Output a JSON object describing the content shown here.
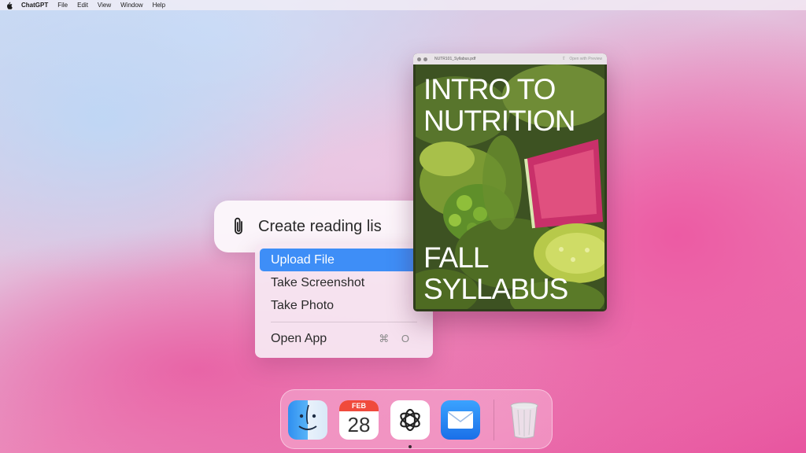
{
  "menubar": {
    "apple_icon": "apple-logo-icon",
    "items": [
      "ChatGPT",
      "File",
      "Edit",
      "View",
      "Window",
      "Help"
    ]
  },
  "prompt": {
    "icon": "paperclip-icon",
    "text": "Create reading lis"
  },
  "context_menu": {
    "items": [
      {
        "label": "Upload File",
        "selected": true
      },
      {
        "label": "Take Screenshot"
      },
      {
        "label": "Take Photo"
      }
    ],
    "open_app": {
      "label": "Open App",
      "shortcut": "⌘ O"
    }
  },
  "pdf_window": {
    "filename": "NUTR101_Syllabus.pdf",
    "open_with": "Open with Preview",
    "cover_title": [
      "INTRO TO",
      "NUTRITION"
    ],
    "cover_subtitle": [
      "FALL",
      "SYLLABUS"
    ]
  },
  "dock": {
    "apps": [
      "finder-icon",
      "calendar-icon",
      "chatgpt-icon",
      "mail-icon",
      "trash-icon"
    ],
    "calendar": {
      "month": "FEB",
      "day": "28"
    }
  },
  "colors": {
    "selection": "#3e8ef7",
    "calendar_red": "#f04a3c"
  }
}
